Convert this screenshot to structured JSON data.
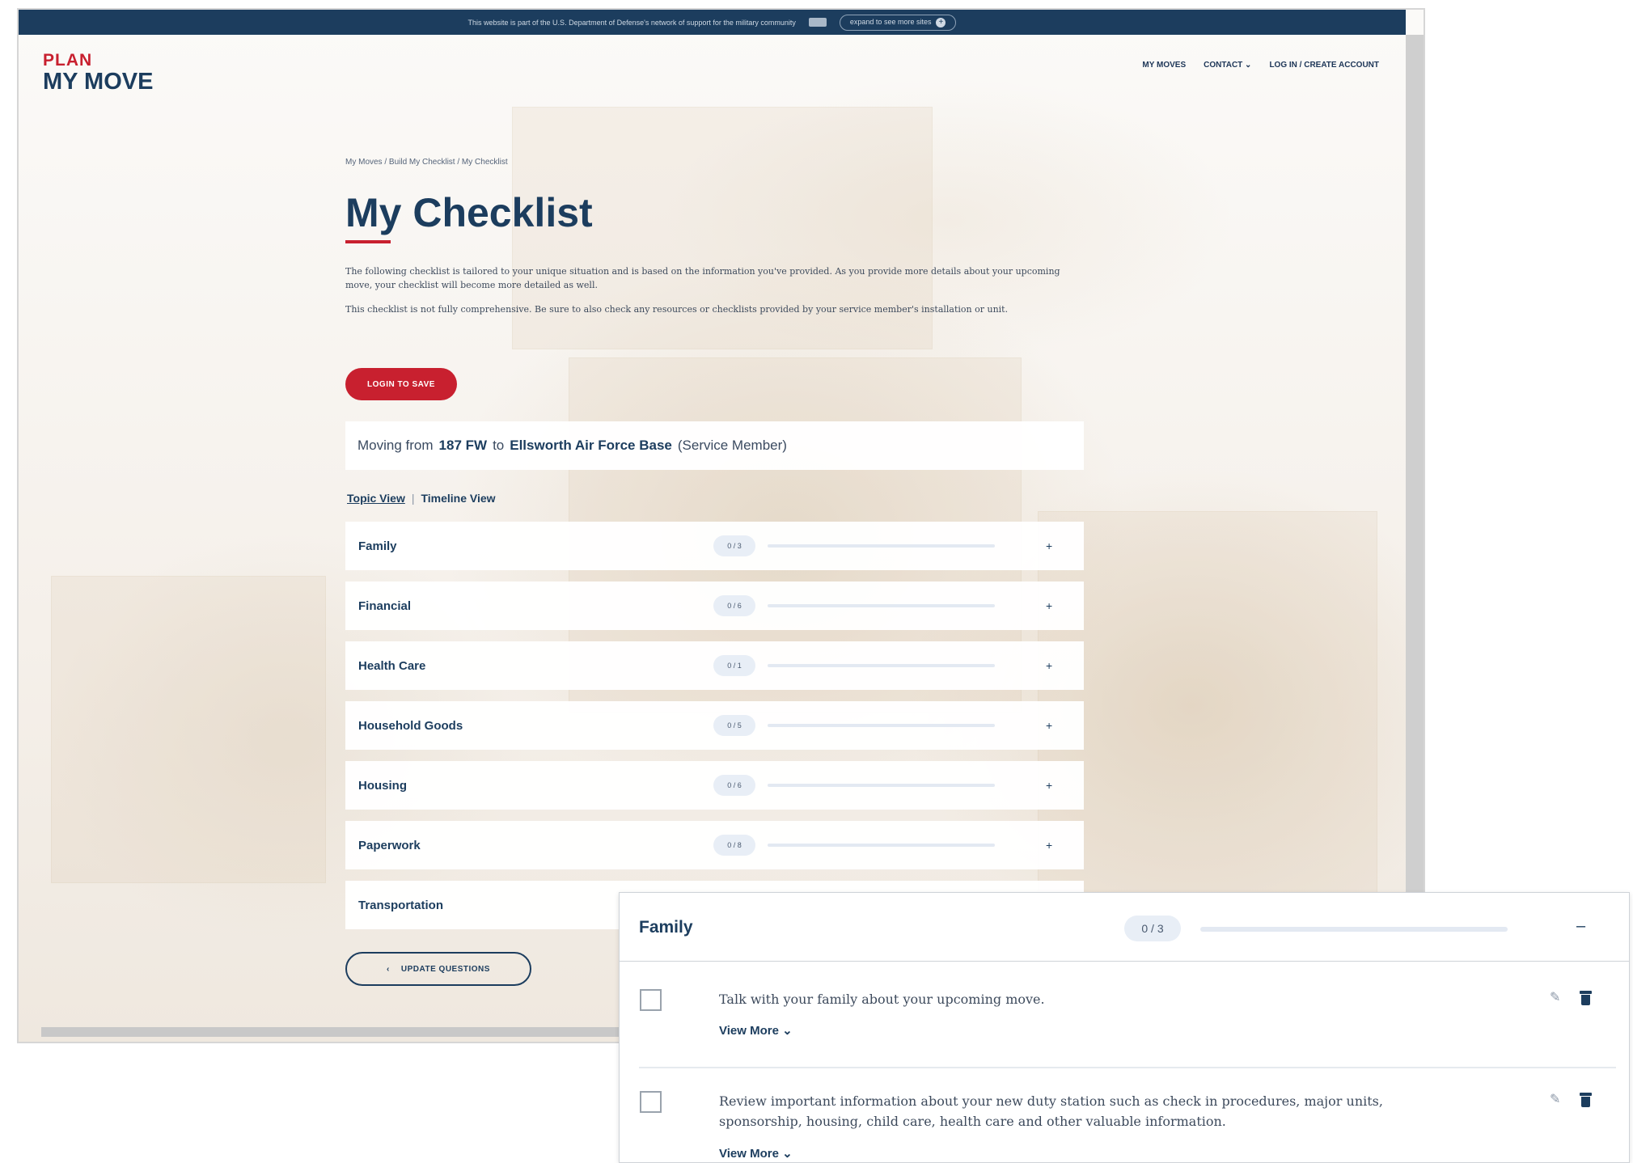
{
  "topbar": {
    "text": "This website is part of the U.S. Department of Defense's network of support for the military community",
    "expand_label": "expand to see more sites",
    "expand_icon": "+"
  },
  "logo": {
    "line1": "PLAN",
    "line2": "MY MOVE"
  },
  "nav": {
    "my_moves": "MY MOVES",
    "contact": "CONTACT ⌄",
    "login": "LOG IN / CREATE ACCOUNT"
  },
  "breadcrumb": "My Moves / Build My Checklist / My Checklist",
  "page_title": "My Checklist",
  "intro": {
    "p1": "The following checklist is tailored to your unique situation and is based on the information you've provided. As you provide more details about your upcoming move, your checklist will become more detailed as well.",
    "p2": "This checklist is not fully comprehensive. Be sure to also check any resources or checklists provided by your service member's installation or unit."
  },
  "login_button": "LOGIN TO SAVE",
  "moving": {
    "prefix": "Moving from",
    "from": "187 FW",
    "to_word": "to",
    "to": "Ellsworth Air Force Base",
    "role": "(Service Member)"
  },
  "views": {
    "topic": "Topic View",
    "separator": "|",
    "timeline": "Timeline View"
  },
  "categories": [
    {
      "label": "Family",
      "count": "0 / 3",
      "progress": 0,
      "icon": "+"
    },
    {
      "label": "Financial",
      "count": "0 / 6",
      "progress": 0,
      "icon": "+"
    },
    {
      "label": "Health Care",
      "count": "0 / 1",
      "progress": 0,
      "icon": "+"
    },
    {
      "label": "Household Goods",
      "count": "0 / 5",
      "progress": 0,
      "icon": "+"
    },
    {
      "label": "Housing",
      "count": "0 / 6",
      "progress": 0,
      "icon": "+"
    },
    {
      "label": "Paperwork",
      "count": "0 / 8",
      "progress": 0,
      "icon": "+"
    },
    {
      "label": "Transportation"
    }
  ],
  "update_button": {
    "icon": "‹",
    "label": "UPDATE QUESTIONS"
  },
  "detail": {
    "label": "Family",
    "count": "0 / 3",
    "progress": 0,
    "collapse_icon": "–",
    "tasks": [
      {
        "text": "Talk with your family about your upcoming move.",
        "more": "View More ⌄"
      },
      {
        "text": "Review important information about your new duty station such as check in procedures, major units, sponsorship, housing, child care, health care and other valuable information.",
        "more": "View More ⌄"
      }
    ],
    "edit_icon": "✎"
  },
  "colors": {
    "navy": "#1c3d5e",
    "red": "#c8202f",
    "pill": "#e8eef6"
  }
}
